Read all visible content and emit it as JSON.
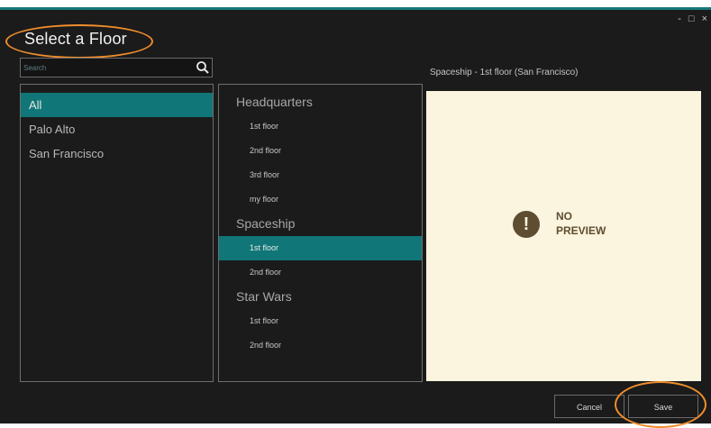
{
  "window": {
    "title": "Select a Floor",
    "controls": {
      "minimize": "-",
      "maximize": "□",
      "close": "×"
    }
  },
  "search": {
    "placeholder": "Search",
    "value": ""
  },
  "locations": [
    {
      "label": "All",
      "selected": true
    },
    {
      "label": "Palo Alto",
      "selected": false
    },
    {
      "label": "San Francisco",
      "selected": false
    }
  ],
  "buildings": [
    {
      "name": "Headquarters",
      "floors": [
        "1st floor",
        "2nd floor",
        "3rd floor",
        "my floor"
      ]
    },
    {
      "name": "Spaceship",
      "floors": [
        "1st floor",
        "2nd floor"
      ]
    },
    {
      "name": "Star Wars",
      "floors": [
        "1st floor",
        "2nd floor"
      ]
    }
  ],
  "selected_floor": {
    "building_index": 1,
    "floor_index": 0
  },
  "preview": {
    "title": "Spaceship - 1st floor (San Francisco)",
    "message_line1": "NO",
    "message_line2": "PREVIEW",
    "icon": "exclamation-icon"
  },
  "buttons": {
    "cancel": "Cancel",
    "save": "Save"
  },
  "colors": {
    "accent": "#117677",
    "background": "#1b1b1b",
    "preview_bg": "#fbf4de",
    "highlight_ring": "#ef8d2c"
  }
}
